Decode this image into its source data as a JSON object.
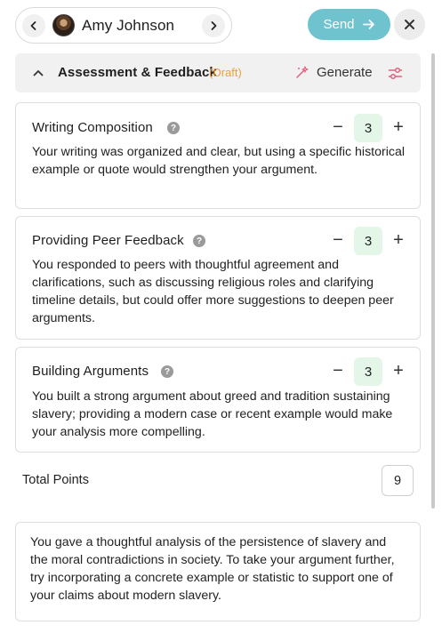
{
  "student": {
    "name": "Amy Johnson"
  },
  "actions": {
    "send_label": "Send"
  },
  "section": {
    "title": "Assessment & Feedback",
    "badge": "(Draft)",
    "generate_label": "Generate"
  },
  "criteria": [
    {
      "title": "Writing Composition",
      "score": "3",
      "feedback": "Your writing was organized and clear, but using a specific historical example or quote would strengthen your argument."
    },
    {
      "title": "Providing Peer Feedback",
      "score": "3",
      "feedback": "You responded to peers with thoughtful agreement and clarifications, such as discussing religious roles and clarifying timeline details, but could offer more suggestions to deepen peer arguments."
    },
    {
      "title": "Building Arguments",
      "score": "3",
      "feedback": "You built a strong argument about greed and tradition sustaining slavery; providing a modern case or recent example would make your analysis more compelling."
    }
  ],
  "total": {
    "label": "Total Points",
    "value": "9"
  },
  "overall_feedback": "You gave a thoughtful analysis of the persistence of slavery and the moral contradictions in society. To take your argument further, try incorporating a concrete example or statistic to support one of your claims about modern slavery.",
  "colors": {
    "send_button": "#6fc3cf",
    "draft_badge": "#e8a33a",
    "generate_icon": "#e0607e",
    "score_bg": "#e3f6e8"
  },
  "icons": {
    "prev": "chevron-left-icon",
    "next": "chevron-right-icon",
    "send": "arrow-right-icon",
    "close": "close-icon",
    "collapse": "chevron-up-icon",
    "generate": "sparkle-icon",
    "settings": "sliders-icon",
    "help": "question-icon"
  }
}
